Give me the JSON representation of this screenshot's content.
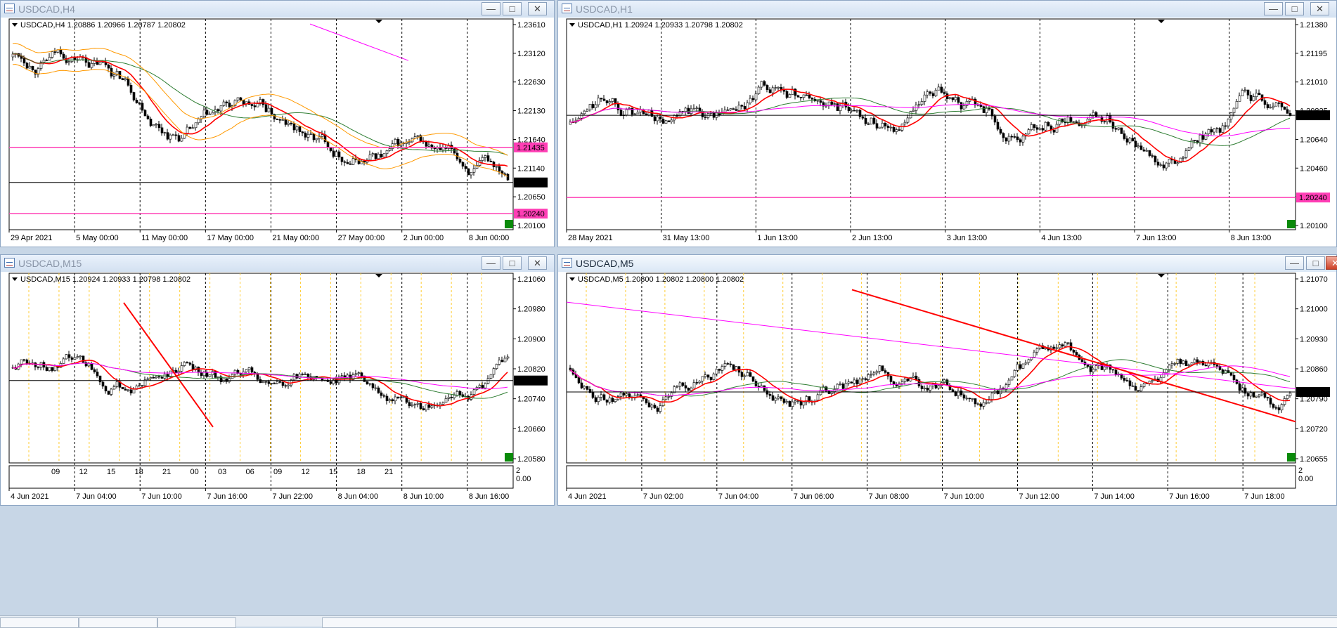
{
  "colors": {
    "bull": "#000000",
    "line_red": "#ff0000",
    "line_green": "#2e7d32",
    "line_magenta": "#ff00ff",
    "bollinger": "#ff9900",
    "hline_pink": "#ff3eb5",
    "period_sep_orange": "#ffcc33",
    "price_tag": "#000000"
  },
  "window_buttons": {
    "minimize": "—",
    "maximize": "□",
    "close": "✕"
  },
  "windows": [
    {
      "id": "h4",
      "active": false,
      "title": "USDCAD,H4",
      "info": "USDCAD,H4  1.20886 1.20966 1.20787 1.20802",
      "current_price": "1.20802",
      "price_axis": [
        "1.23610",
        "1.23120",
        "1.22630",
        "1.22130",
        "1.21640",
        "1.21140",
        "1.20650",
        "1.20100"
      ],
      "price_min": 1.1995,
      "price_max": 1.2375,
      "date_axis": [
        "29 Apr 2021",
        "5 May 00:00",
        "11 May 00:00",
        "17 May 00:00",
        "21 May 00:00",
        "27 May 00:00",
        "2 Jun 00:00",
        "8 Jun 00:00"
      ],
      "hlines": [
        {
          "label": "1.21435",
          "price": 1.21435
        },
        {
          "label": "1.20240",
          "price": 1.2024
        }
      ],
      "sub_axis": []
    },
    {
      "id": "h1",
      "active": false,
      "title": "USDCAD,H1",
      "info": "USDCAD,H1  1.20924 1.20933 1.20798 1.20802",
      "current_price": "1.20802",
      "price_axis": [
        "1.21380",
        "1.21195",
        "1.21010",
        "1.20825",
        "1.20640",
        "1.20460",
        "1.20280",
        "1.20100"
      ],
      "price_min": 1.2002,
      "price_max": 1.2146,
      "date_axis": [
        "28 May 2021",
        "31 May 13:00",
        "1 Jun 13:00",
        "2 Jun 13:00",
        "3 Jun 13:00",
        "4 Jun 13:00",
        "7 Jun 13:00",
        "8 Jun 13:00"
      ],
      "hlines": [
        {
          "label": "1.20240",
          "price": 1.2024
        }
      ],
      "sub_axis": []
    },
    {
      "id": "m15",
      "active": false,
      "title": "USDCAD,M15",
      "info": "USDCAD,M15  1.20924 1.20933 1.20798 1.20802",
      "current_price": "1.20802",
      "price_axis": [
        "1.21060",
        "1.20980",
        "1.20900",
        "1.20820",
        "1.20740",
        "1.20660",
        "1.20580"
      ],
      "price_min": 1.2055,
      "price_max": 1.2113,
      "date_axis": [
        "4 Jun 2021",
        "7 Jun 04:00",
        "7 Jun 10:00",
        "7 Jun 16:00",
        "7 Jun 22:00",
        "8 Jun 04:00",
        "8 Jun 10:00",
        "8 Jun 16:00"
      ],
      "hlines": [],
      "sub_axis": [
        "09",
        "12",
        "15",
        "18",
        "21",
        "00",
        "03",
        "06",
        "09",
        "12",
        "15",
        "18",
        "21"
      ],
      "sub_scale": [
        "2",
        "0.00"
      ]
    },
    {
      "id": "m5",
      "active": true,
      "title": "USDCAD,M5",
      "info": "USDCAD,M5  1.20800 1.20802 1.20800 1.20802",
      "current_price": "1.20802",
      "price_axis": [
        "1.21070",
        "1.21000",
        "1.20930",
        "1.20860",
        "1.20790",
        "1.20720",
        "1.20655"
      ],
      "price_min": 1.2063,
      "price_max": 1.2109,
      "date_axis": [
        "4 Jun 2021",
        "7 Jun 02:00",
        "7 Jun 04:00",
        "7 Jun 06:00",
        "7 Jun 08:00",
        "7 Jun 10:00",
        "7 Jun 12:00",
        "7 Jun 14:00",
        "7 Jun 16:00",
        "7 Jun 18:00"
      ],
      "hlines": [],
      "sub_axis": [],
      "sub_scale": [
        "2",
        "0.00"
      ]
    }
  ]
}
